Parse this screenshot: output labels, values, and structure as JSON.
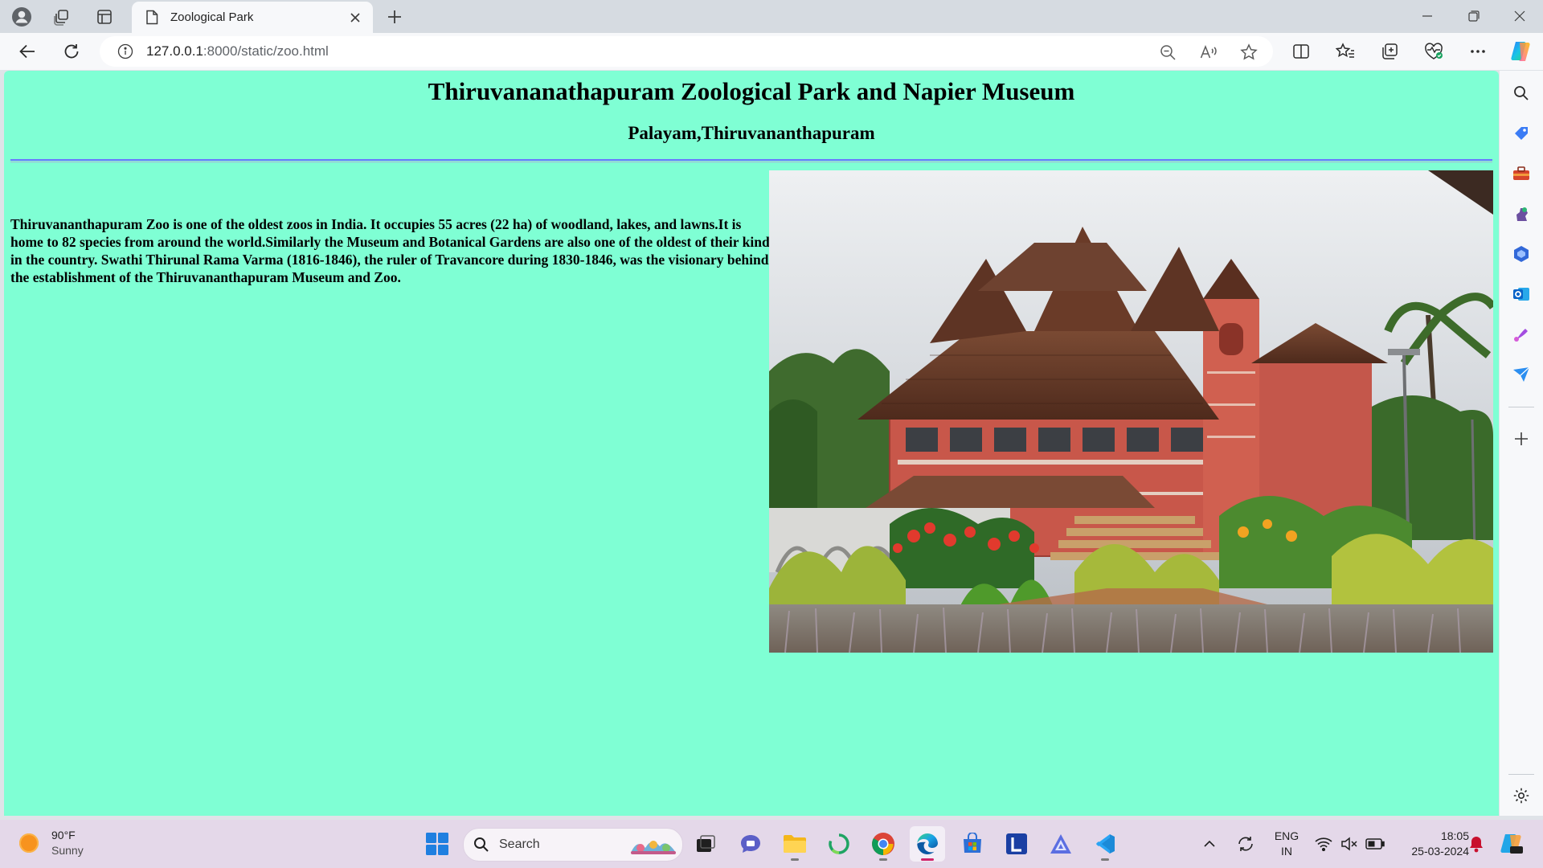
{
  "browser": {
    "tab_title": "Zoological Park",
    "url_host": "127.0.0.1",
    "url_rest": ":8000/static/zoo.html"
  },
  "page": {
    "heading": "Thiruvananathapuram Zoological Park and Napier Museum",
    "subheading": "Palayam,Thiruvananthapuram",
    "paragraph": "Thiruvananthapuram Zoo is one of the oldest zoos in India. It occupies 55 acres (22 ha) of woodland, lakes, and lawns.It is home to 82 species from around the world.Similarly the Museum and Botanical Gardens are also one of the oldest of their kind in the country. Swathi Thirunal Rama Varma (1816-1846), the ruler of Travancore during 1830-1846, was the visionary behind the establishment of the Thiruvananthapuram Museum and Zoo.",
    "background_color": "#7fffd4",
    "rule_color": "#6a75ff"
  },
  "taskbar": {
    "weather_temp": "90°F",
    "weather_desc": "Sunny",
    "search_label": "Search",
    "lang_line1": "ENG",
    "lang_line2": "IN",
    "time": "18:05",
    "date": "25-03-2024"
  },
  "icons": {
    "tabstrip": [
      "profile-icon",
      "workspaces-icon",
      "tab-actions-icon",
      "document-icon",
      "close-icon",
      "plus-icon",
      "minimize-icon",
      "restore-icon",
      "window-close-icon"
    ],
    "toolbar": [
      "back-arrow-icon",
      "refresh-icon",
      "info-icon",
      "zoom-out-icon",
      "read-aloud-icon",
      "star-icon",
      "split-screen-icon",
      "favorites-icon",
      "collections-icon",
      "browser-essentials-icon",
      "more-icon",
      "copilot-icon"
    ],
    "sidebar": [
      "search-icon",
      "shopping-tag-icon",
      "tools-icon",
      "games-icon",
      "office-icon",
      "outlook-icon",
      "designer-icon",
      "send-icon",
      "add-icon",
      "settings-icon"
    ]
  }
}
